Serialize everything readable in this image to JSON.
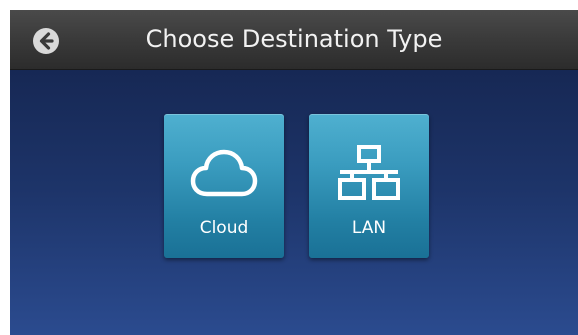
{
  "header": {
    "title": "Choose Destination Type",
    "back_icon": "back-arrow-circle-icon"
  },
  "options": [
    {
      "label": "Cloud",
      "icon": "cloud-icon"
    },
    {
      "label": "LAN",
      "icon": "network-icon"
    }
  ],
  "colors": {
    "header_bg": "#3a3a3a",
    "screen_bg_top": "#13224a",
    "screen_bg_bottom": "#2b4b8f",
    "tile_top": "#4fb0d0",
    "tile_bottom": "#1a7196",
    "text": "#ffffff"
  }
}
